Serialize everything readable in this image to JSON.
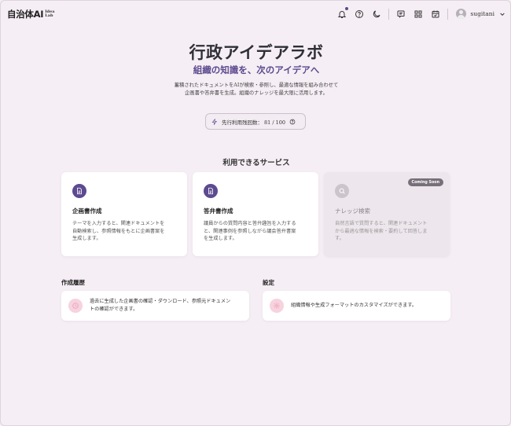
{
  "header": {
    "logo_main": "自治体AI",
    "logo_sub_1": "Idea",
    "logo_sub_2": "Lab",
    "icons": [
      "bell-icon",
      "help-icon",
      "moon-icon",
      "chat-icon",
      "grid-icon",
      "calendar-icon"
    ],
    "username": "sugitani"
  },
  "hero": {
    "title": "行政アイデアラボ",
    "subtitle": "組織の知識を、次のアイデアへ",
    "desc_line1": "蓄積されたドキュメントをAIが検索・参照し、最適な情報を組み合わせて",
    "desc_line2": "企画書や答弁書を生成。組織のナレッジを最大限に活用します。"
  },
  "usage": {
    "text": "先行利用残回数： 81 / 100"
  },
  "services": {
    "title": "利用できるサービス",
    "items": [
      {
        "title": "企画書作成",
        "desc_line1": "テーマを入力すると、関連ドキュメントを",
        "desc_line2": "自動検索し、参照情報をもとに企画書案を",
        "desc_line3": "生成します。"
      },
      {
        "title": "答弁書作成",
        "desc_line1": "議員からの質問内容と答弁趣旨を入力する",
        "desc_line2": "と、関連事例を参照しながら議会答弁書案",
        "desc_line3": "を生成します。"
      },
      {
        "title": "ナレッジ検索",
        "badge": "Coming Soon",
        "desc_line1": "自然言語で質問すると、関連ドキュメント",
        "desc_line2": "から最適な情報を検索・要約して回答しま",
        "desc_line3": "す。"
      }
    ]
  },
  "history": {
    "title": "作成履歴",
    "desc_line1": "過去に生成した企画書の確認・ダウンロード、参照元ドキュメン",
    "desc_line2": "トの確認ができます。"
  },
  "settings": {
    "title": "設定",
    "desc": "組織情報や生成フォーマットのカスタマイズができます。"
  },
  "colors": {
    "accent": "#5d4a8f",
    "background": "#f5eef4",
    "pink_icon_bg": "#f6d3de"
  }
}
